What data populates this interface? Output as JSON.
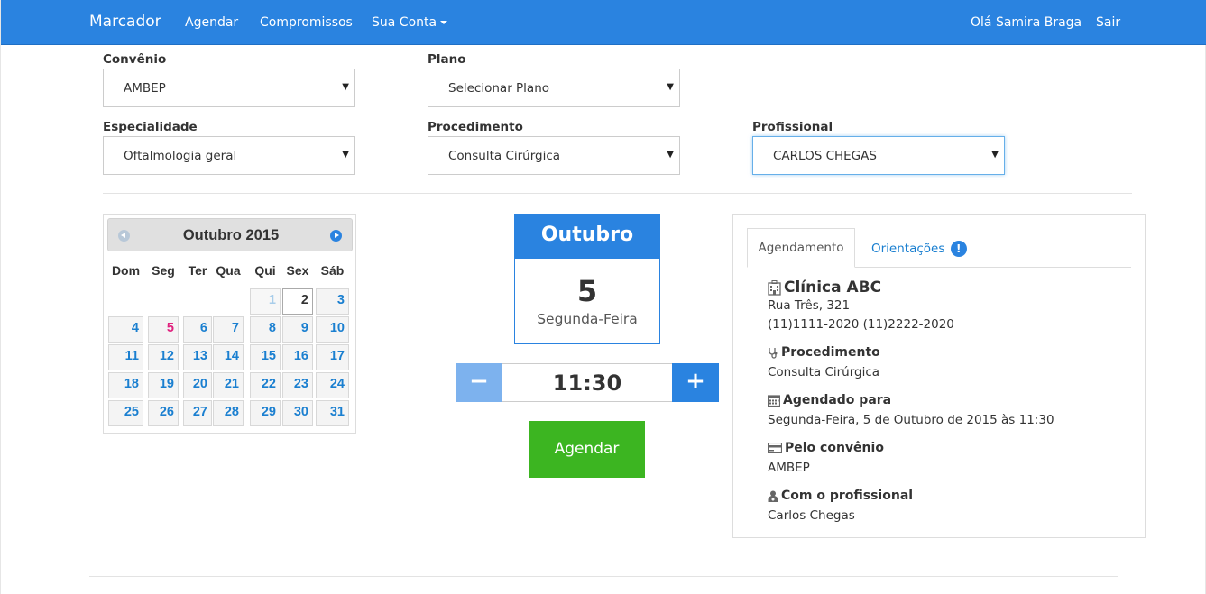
{
  "navbar": {
    "brand": "Marcador",
    "links": [
      "Agendar",
      "Compromissos",
      "Sua Conta"
    ],
    "greeting": "Olá Samira Braga",
    "logout": "Sair",
    "color": "#2a83e0"
  },
  "form": {
    "convenio": {
      "label": "Convênio",
      "value": "AMBEP"
    },
    "plano": {
      "label": "Plano",
      "value": "Selecionar Plano"
    },
    "especialidade": {
      "label": "Especialidade",
      "value": "Oftalmologia geral"
    },
    "procedimento": {
      "label": "Procedimento",
      "value": "Consulta Cirúrgica"
    },
    "profissional": {
      "label": "Profissional",
      "value": "CARLOS CHEGAS"
    }
  },
  "calendar": {
    "title": "Outubro 2015",
    "weekdays": [
      "Dom",
      "Seg",
      "Ter",
      "Qua",
      "Qui",
      "Sex",
      "Sáb"
    ],
    "days": [
      "1",
      "2",
      "3",
      "4",
      "5",
      "6",
      "7",
      "8",
      "9",
      "10",
      "11",
      "12",
      "13",
      "14",
      "15",
      "16",
      "17",
      "18",
      "19",
      "20",
      "21",
      "22",
      "23",
      "24",
      "25",
      "26",
      "27",
      "28",
      "29",
      "30",
      "31"
    ],
    "first_weekday_index": 4,
    "today": "2",
    "selected": "5"
  },
  "daycard": {
    "month": "Outubro",
    "day": "5",
    "weekday": "Segunda-Feira"
  },
  "time": {
    "minus": "−",
    "value": "11:30",
    "plus": "+"
  },
  "submit_label": "Agendar",
  "summary": {
    "tabs": {
      "active": "Agendamento",
      "other": "Orientações",
      "badge": "!"
    },
    "clinic": {
      "name": "Clínica ABC",
      "address": "Rua Três, 321",
      "phones": "(11)1111-2020 (11)2222-2020",
      "icon": "hospital-icon"
    },
    "procedimento": {
      "title": "Procedimento",
      "value": "Consulta Cirúrgica",
      "icon": "stethoscope-icon"
    },
    "agendado": {
      "title": "Agendado para",
      "value": "Segunda-Feira, 5 de Outubro de 2015 às 11:30",
      "icon": "calendar-icon"
    },
    "convenio": {
      "title": "Pelo convênio",
      "value": "AMBEP",
      "icon": "credit-card-icon"
    },
    "profissional": {
      "title": "Com o profissional",
      "value": "Carlos Chegas",
      "icon": "user-md-icon"
    }
  }
}
